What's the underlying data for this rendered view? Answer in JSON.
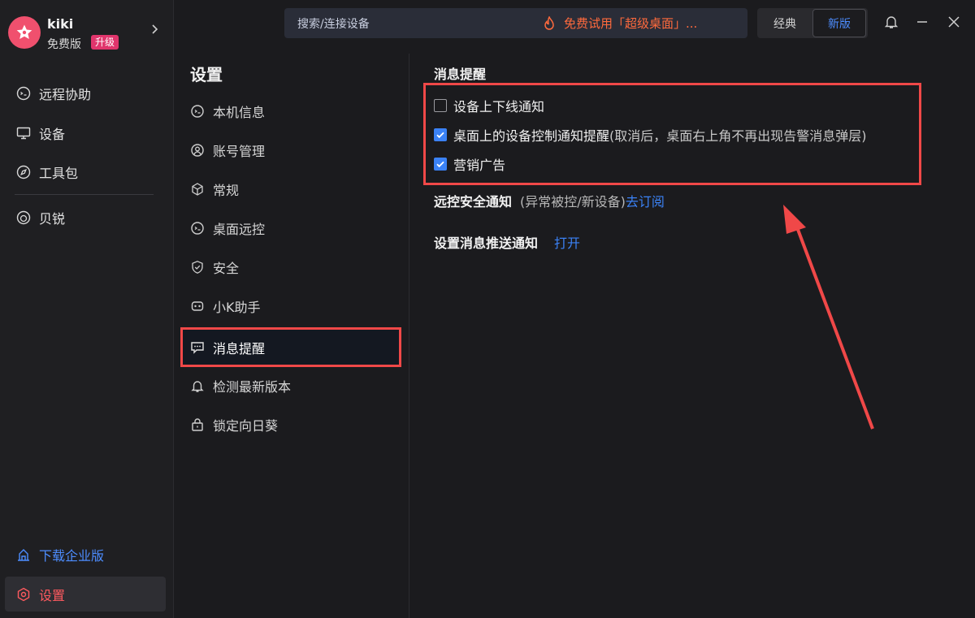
{
  "profile": {
    "username": "kiki",
    "plan": "免费版",
    "upgrade": "升级"
  },
  "sidebar": {
    "items": [
      {
        "label": "远程协助",
        "icon": "remote-assist-icon"
      },
      {
        "label": "设备",
        "icon": "monitor-icon"
      },
      {
        "label": "工具包",
        "icon": "compass-icon"
      },
      {
        "label": "贝锐",
        "icon": "beirui-icon"
      }
    ],
    "download": "下载企业版",
    "settings": "设置"
  },
  "titlebar": {
    "search": "搜索/连接设备",
    "promo": "免费试用「超级桌面」...",
    "mode_classic": "经典",
    "mode_new": "新版"
  },
  "settings_nav": {
    "title": "设置",
    "items": [
      {
        "label": "本机信息"
      },
      {
        "label": "账号管理"
      },
      {
        "label": "常规"
      },
      {
        "label": "桌面远控"
      },
      {
        "label": "安全"
      },
      {
        "label": "小K助手"
      },
      {
        "label": "消息提醒"
      },
      {
        "label": "检测最新版本"
      },
      {
        "label": "锁定向日葵"
      }
    ]
  },
  "content": {
    "section_title": "消息提醒",
    "options": [
      {
        "label": "设备上下线通知",
        "checked": false,
        "note": ""
      },
      {
        "label": "桌面上的设备控制通知提醒",
        "checked": true,
        "note": "(取消后，桌面右上角不再出现告警消息弹层)"
      },
      {
        "label": "营销广告",
        "checked": true,
        "note": ""
      }
    ],
    "security": {
      "label": "远控安全通知",
      "note": "(异常被控/新设备)",
      "link": "去订阅"
    },
    "push": {
      "label": "设置消息推送通知",
      "link": "打开"
    }
  },
  "colors": {
    "accent": "#3b82f6",
    "highlight": "#f04848",
    "upgrade": "#e0356c",
    "promo": "#ff6a3d"
  }
}
